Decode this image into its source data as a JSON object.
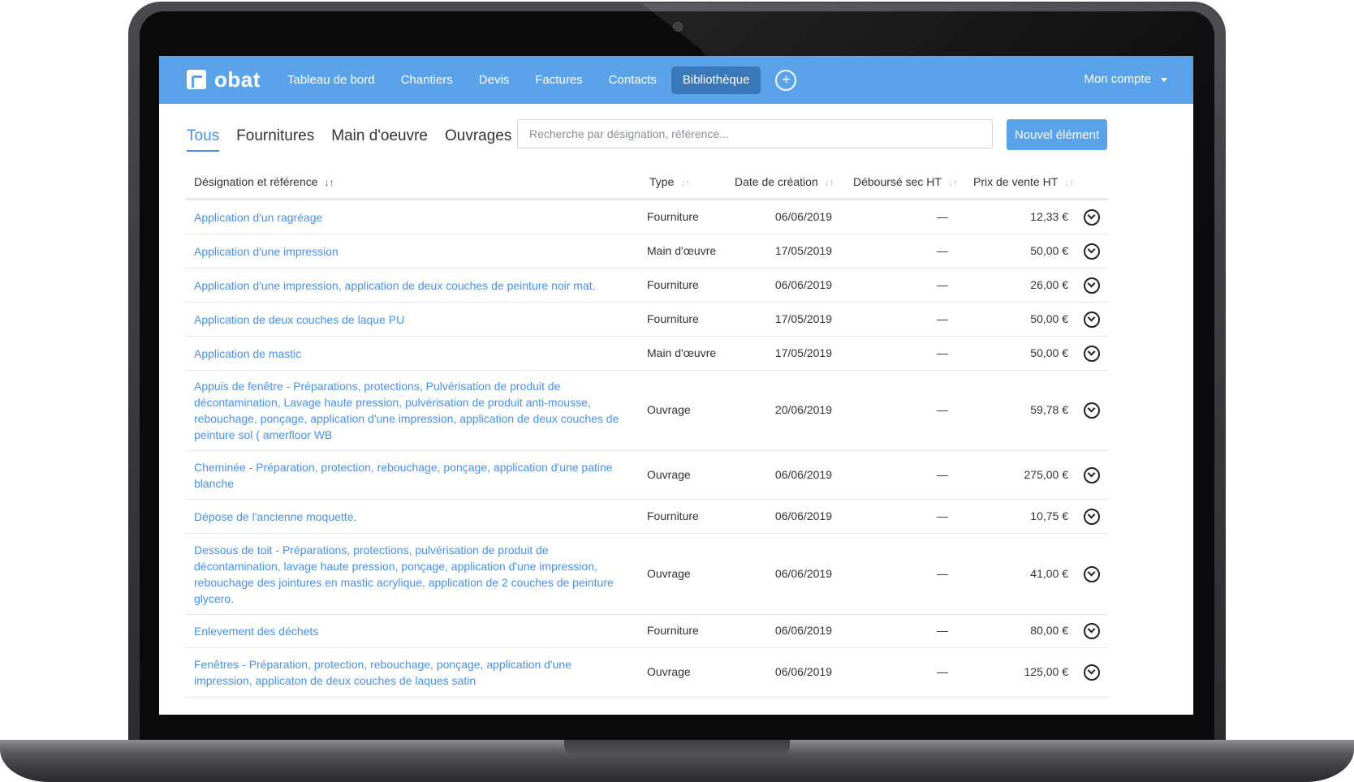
{
  "app": {
    "logo_text": "obat",
    "nav": [
      "Tableau de bord",
      "Chantiers",
      "Devis",
      "Factures",
      "Contacts",
      "Bibliothèque"
    ],
    "nav_active_index": 5,
    "nav_add_symbol": "+",
    "account_label": "Mon compte"
  },
  "library": {
    "tabs": [
      "Tous",
      "Fournitures",
      "Main d'oeuvre",
      "Ouvrages"
    ],
    "active_tab": "Tous",
    "search_placeholder": "Recherche par désignation, référence...",
    "new_button": "Nouvel élément",
    "columns": {
      "name": "Désignation et référence",
      "type": "Type",
      "date": "Date de création",
      "deb": "Déboursé sec HT",
      "price": "Prix de vente HT"
    },
    "rows": [
      {
        "name": "Application d'un ragréage",
        "type": "Fourniture",
        "date": "06/06/2019",
        "deb": "—",
        "price": "12,33 €"
      },
      {
        "name": "Application d'une impression",
        "type": "Main d'œuvre",
        "date": "17/05/2019",
        "deb": "—",
        "price": "50,00 €"
      },
      {
        "name": "Application d'une impression, application de deux couches de peinture noir mat.",
        "type": "Fourniture",
        "date": "06/06/2019",
        "deb": "—",
        "price": "26,00 €"
      },
      {
        "name": "Application de deux couches de laque PU",
        "type": "Fourniture",
        "date": "17/05/2019",
        "deb": "—",
        "price": "50,00 €"
      },
      {
        "name": "Application de mastic",
        "type": "Main d'œuvre",
        "date": "17/05/2019",
        "deb": "—",
        "price": "50,00 €"
      },
      {
        "name": "Appuis de fenêtre - Préparations, protections, Pulvérisation de produit de décontamination, Lavage haute pression, pulvérisation de produit anti-mousse, rebouchage, ponçage, application d'une impression, application de deux couches de peinture sol ( amerfloor WB",
        "type": "Ouvrage",
        "date": "20/06/2019",
        "deb": "—",
        "price": "59,78 €"
      },
      {
        "name": "Cheminée - Préparation, protection, rebouchage, ponçage, application d'une patine blanche",
        "type": "Ouvrage",
        "date": "06/06/2019",
        "deb": "—",
        "price": "275,00 €"
      },
      {
        "name": "Dépose de l'ancienne moquette.",
        "type": "Fourniture",
        "date": "06/06/2019",
        "deb": "—",
        "price": "10,75 €"
      },
      {
        "name": "Dessous de toit - Préparations, protections, pulvérisation de produit de décontamination, lavage haute pression, ponçage, application d'une impression, rebouchage des jointures en mastic acrylique, application de 2 couches de peinture glycero.",
        "type": "Ouvrage",
        "date": "06/06/2019",
        "deb": "—",
        "price": "41,00 €"
      },
      {
        "name": "Enlevement des déchets",
        "type": "Fourniture",
        "date": "06/06/2019",
        "deb": "—",
        "price": "80,00 €"
      },
      {
        "name": "Fenêtres - Préparation, protection, rebouchage, ponçage, application d'une impression, applicaton de deux couches de laques satin",
        "type": "Ouvrage",
        "date": "06/06/2019",
        "deb": "—",
        "price": "125,00 €"
      }
    ]
  }
}
